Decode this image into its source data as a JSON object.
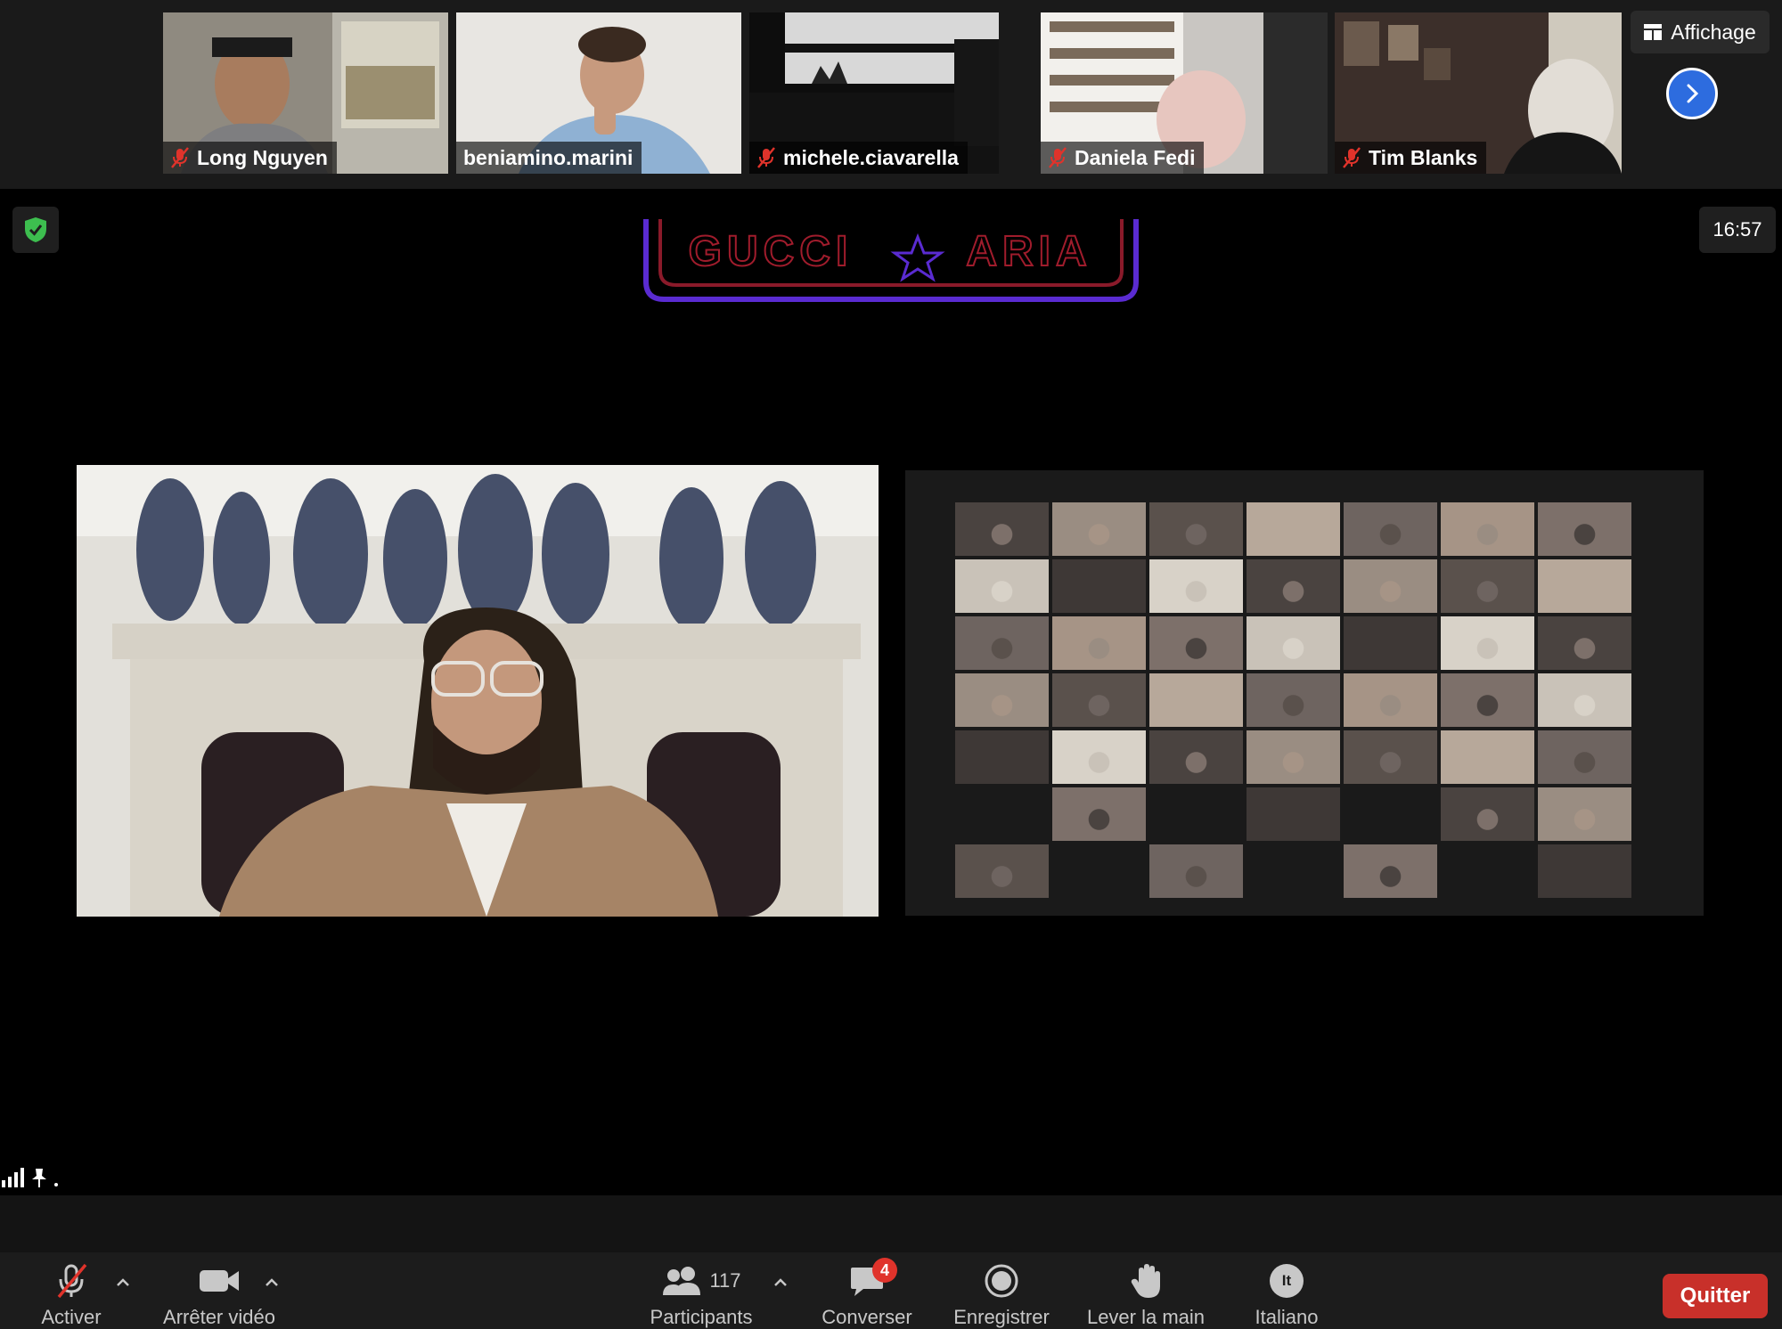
{
  "participants_strip": [
    {
      "name": "Long Nguyen",
      "muted": true
    },
    {
      "name": "beniamino.marini",
      "muted": false
    },
    {
      "name": "michele.ciavarella",
      "muted": true
    },
    {
      "name": "Daniela Fedi",
      "muted": true
    },
    {
      "name": "Tim Blanks",
      "muted": true
    }
  ],
  "view_button_label": "Affichage",
  "clock": "16:57",
  "event_sign": {
    "left": "GUCCI",
    "right": "ARIA"
  },
  "toolbar": {
    "unmute_label": "Activer",
    "stop_video_label": "Arrêter vidéo",
    "participants_label": "Participants",
    "participants_count": "117",
    "chat_label": "Converser",
    "chat_badge": "4",
    "record_label": "Enregistrer",
    "raise_hand_label": "Lever la main",
    "language_label": "Italiano",
    "language_code": "It",
    "leave_label": "Quitter"
  },
  "colors": {
    "accent_blue": "#2d6cdf",
    "leave_red": "#c8302a",
    "badge_red": "#e0332b",
    "shield_green": "#3dbe4f"
  }
}
